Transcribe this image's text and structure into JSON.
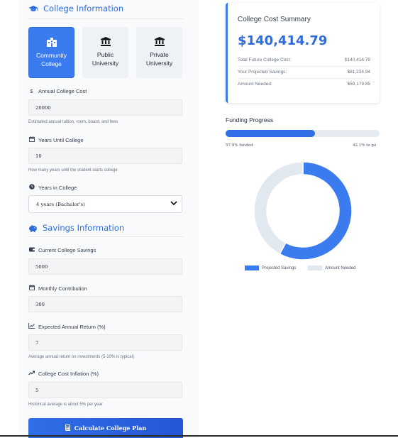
{
  "college_section": {
    "title": "College Information",
    "types": [
      {
        "label_line1": "Community",
        "label_line2": "College",
        "icon": "school-icon",
        "active": true
      },
      {
        "label_line1": "Public",
        "label_line2": "University",
        "icon": "landmark-icon",
        "active": false
      },
      {
        "label_line1": "Private",
        "label_line2": "University",
        "icon": "landmark-icon",
        "active": false
      }
    ],
    "annual_cost": {
      "label": "Annual College Cost",
      "icon": "dollar-icon",
      "value": "20000",
      "help": "Estimated annual tuition, room, board, and fees"
    },
    "years_until": {
      "label": "Years Until College",
      "icon": "calendar-icon",
      "value": "10",
      "help": "How many years until the student starts college"
    },
    "years_in": {
      "label": "Years in College",
      "icon": "clock-icon",
      "selected": "4 years (Bachelor's)"
    }
  },
  "savings_section": {
    "title": "Savings Information",
    "current_savings": {
      "label": "Current College Savings",
      "icon": "wallet-icon",
      "value": "5000"
    },
    "monthly": {
      "label": "Monthly Contribution",
      "icon": "calendar-icon",
      "value": "300"
    },
    "return": {
      "label": "Expected Annual Return (%)",
      "icon": "chart-line-icon",
      "value": "7",
      "help": "Average annual return on investments (5-10% is typical)"
    },
    "inflation": {
      "label": "College Cost Inflation (%)",
      "icon": "trend-up-icon",
      "value": "5",
      "help": "Historical average is about 5% per year"
    }
  },
  "calculate_button": "Calculate College Plan",
  "summary": {
    "title": "College Cost Summary",
    "total": "$140,414.79",
    "rows": [
      {
        "label": "Total Future College Cost:",
        "value": "$140,414.79"
      },
      {
        "label": "Your Projected Savings:",
        "value": "$81,234.94"
      },
      {
        "label": "Amount Needed:",
        "value": "$59,179.85"
      }
    ]
  },
  "funding": {
    "title": "Funding Progress",
    "funded_fraction": 0.579,
    "funded_text": "57.9% funded",
    "to_go_text": "42.1% to go"
  },
  "chart_data": {
    "type": "pie",
    "categories": [
      "Projected Savings",
      "Amount Needed"
    ],
    "values": [
      81234.94,
      59179.85
    ],
    "colors": [
      "#3a7bef",
      "#e2e8f0"
    ],
    "legend_position": "bottom"
  },
  "colors": {
    "accent": "#3a7bef",
    "track": "#e5e9f0",
    "panel": "#f8fafc"
  }
}
